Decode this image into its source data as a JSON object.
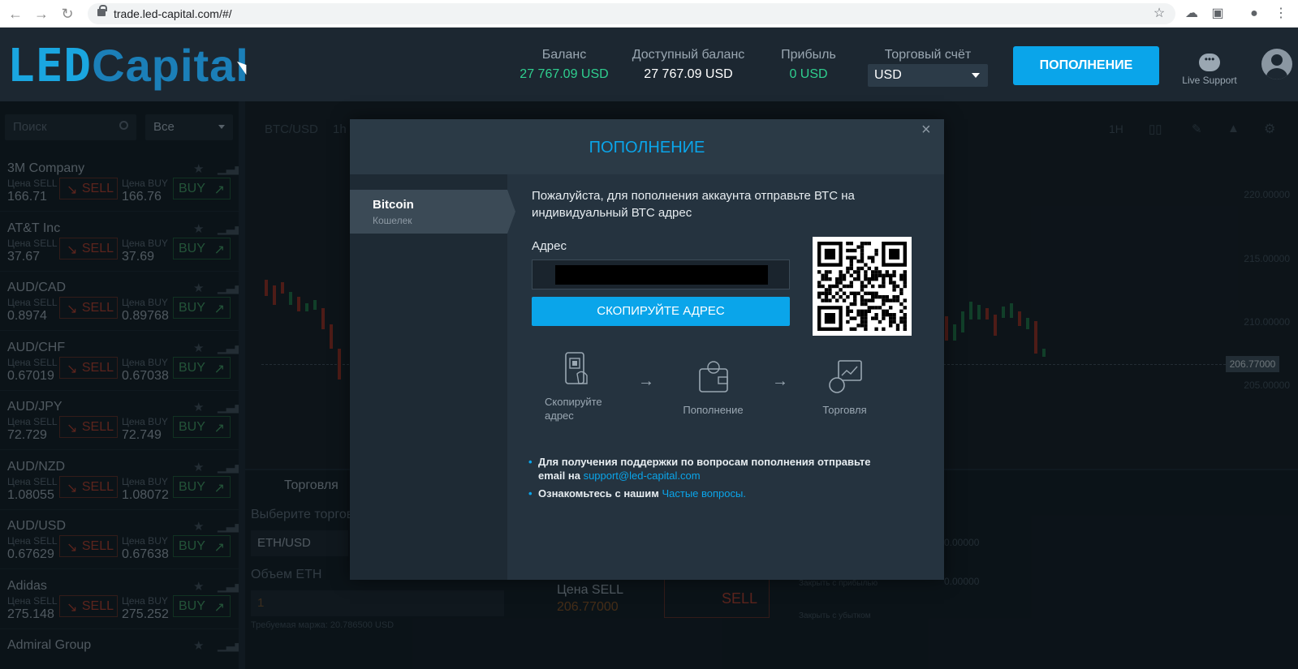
{
  "browser": {
    "url": "trade.led-capital.com/#/"
  },
  "header": {
    "logo_led": "LED",
    "logo_capital": "Capital",
    "balance_label": "Баланс",
    "balance_value": "27 767.09 USD",
    "available_label": "Доступный баланс",
    "available_value": "27 767.09 USD",
    "profit_label": "Прибыль",
    "profit_value": "0 USD",
    "account_label": "Торговый счёт",
    "account_value": "USD",
    "topup_label": "ПОПОЛНЕНИЕ",
    "support_label": "Live Support"
  },
  "sidebar": {
    "search_placeholder": "Поиск",
    "filter_value": "Все",
    "sell_label": "SELL",
    "buy_label": "BUY",
    "sell_price_label": "Цена SELL",
    "buy_price_label": "Цена BUY",
    "assets": [
      {
        "name": "3M Company",
        "sell": "166.71",
        "buy": "166.76"
      },
      {
        "name": "AT&T Inc",
        "sell": "37.67",
        "buy": "37.69"
      },
      {
        "name": "AUD/CAD",
        "sell": "0.8974",
        "buy": "0.89768"
      },
      {
        "name": "AUD/CHF",
        "sell": "0.67019",
        "buy": "0.67038"
      },
      {
        "name": "AUD/JPY",
        "sell": "72.729",
        "buy": "72.749"
      },
      {
        "name": "AUD/NZD",
        "sell": "1.08055",
        "buy": "1.08072"
      },
      {
        "name": "AUD/USD",
        "sell": "0.67629",
        "buy": "0.67638"
      },
      {
        "name": "Adidas",
        "sell": "275.148",
        "buy": "275.252"
      },
      {
        "name": "Admiral Group",
        "sell": "",
        "buy": ""
      }
    ]
  },
  "chart": {
    "symbol": "BTC/USD",
    "timeframe": "1h",
    "timeframe_right": "1H",
    "price_ticks": [
      "220.00000",
      "215.00000",
      "210.00000",
      "205.00000"
    ],
    "current_price": "206.77000"
  },
  "trade_panel": {
    "tab_label": "Торговля",
    "choose_label": "Выберите торгов",
    "pair_value": "ETH/USD",
    "volume_label": "Объем ETH",
    "volume_value": "1",
    "margin_text": "Требуемая маржа: 20.786500 USD",
    "sell_price_label": "Цена SELL",
    "sell_price_value": "206.77000",
    "sell_btn": "SELL",
    "take_profit_label": "Закрыть с прибылью",
    "stop_loss_label": "Закрыть с убытком",
    "tp_value": "0.00000",
    "sl_value": "0.00000"
  },
  "modal": {
    "title": "ПОПОЛНЕНИЕ",
    "method_name": "Bitcoin",
    "method_sub": "Кошелек",
    "instruction": "Пожалуйста, для пополнения аккаунта отправьте ВТС на индивидуальный ВТС адрес",
    "address_label": "Адрес",
    "copy_button": "СКОПИРУЙТЕ АДРЕС",
    "step1": "Скопируйте адрес",
    "step2": "Пополнение",
    "step3": "Торговля",
    "note1_text": "Для получения поддержки по вопросам пополнения отправьте email на",
    "note1_link": "support@led-capital.com",
    "note2_text": "Ознакомьтесь с нашим",
    "note2_link": "Частые вопросы."
  },
  "colors": {
    "accent": "#0aa5ea",
    "profit_green": "#2fcf8f",
    "sell_red": "#a33a2a",
    "buy_green": "#3c8f5c"
  }
}
